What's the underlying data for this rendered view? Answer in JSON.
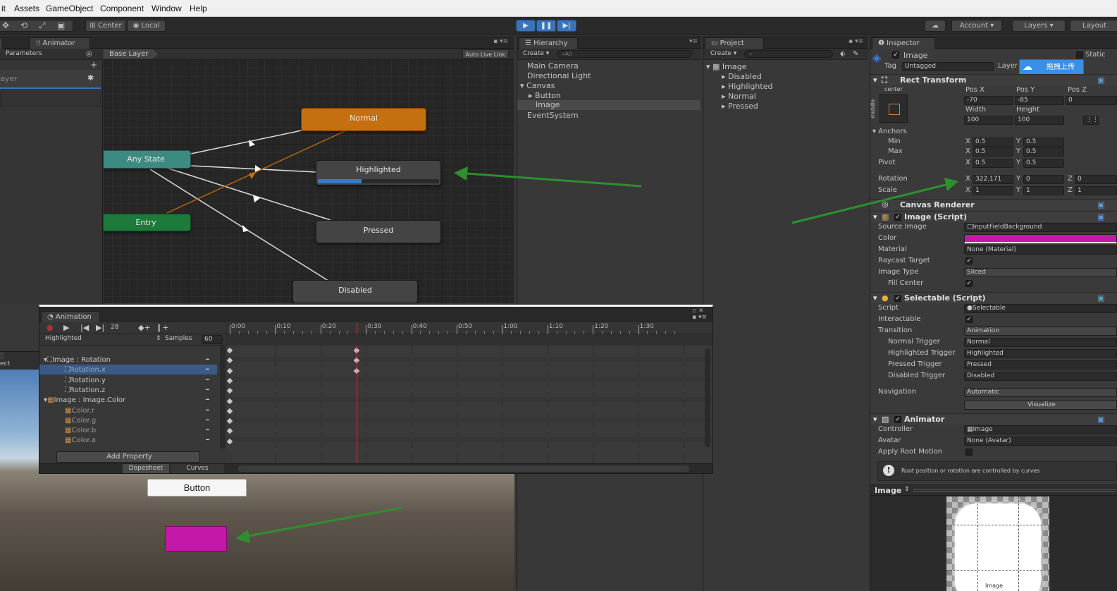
{
  "menu": [
    "it",
    "Assets",
    "GameObject",
    "Component",
    "Window",
    "Help"
  ],
  "toolbar": {
    "center": "Center",
    "local": "Local",
    "account": "Account",
    "layers": "Layers",
    "layout": "Layout"
  },
  "animator": {
    "tab": "Animator",
    "params_tab": "Parameters",
    "layer_partial": "ayer",
    "base_layer": "Base Layer",
    "auto_live_link": "Auto Live Link",
    "nodes": {
      "normal": "Normal",
      "any_state": "Any State",
      "highlighted": "Highlighted",
      "entry": "Entry",
      "pressed": "Pressed",
      "disabled": "Disabled"
    },
    "highlighted_progress": 0.36
  },
  "hierarchy": {
    "tab": "Hierarchy",
    "create": "Create",
    "search_placeholder": "All",
    "items": [
      "Main Camera",
      "Directional Light",
      "Canvas",
      "Button",
      "Image",
      "EventSystem"
    ]
  },
  "project": {
    "tab": "Project",
    "create": "Create",
    "items": [
      "Image",
      "Disabled",
      "Highlighted",
      "Normal",
      "Pressed"
    ]
  },
  "inspector": {
    "tab": "Inspector",
    "object_name": "Image",
    "static": "Static",
    "tag_label": "Tag",
    "tag_value": "Untagged",
    "layer_label": "Layer",
    "upload_btn": "拖拽上传",
    "rect": {
      "title": "Rect Transform",
      "anchor_preset": "center",
      "middle": "middle",
      "pos_x_label": "Pos X",
      "pos_y_label": "Pos Y",
      "pos_z_label": "Pos Z",
      "pos_x": "-70",
      "pos_y": "-85",
      "pos_z": "0",
      "width_label": "Width",
      "height_label": "Height",
      "width": "100",
      "height": "100",
      "anchors": "Anchors",
      "min": "Min",
      "max": "Max",
      "pivot": "Pivot",
      "min_x": "0.5",
      "min_y": "0.5",
      "max_x": "0.5",
      "max_y": "0.5",
      "pivot_x": "0.5",
      "pivot_y": "0.5",
      "rotation": "Rotation",
      "rot_x": "322.171",
      "rot_y": "0",
      "rot_z": "0",
      "scale": "Scale",
      "scale_x": "1",
      "scale_y": "1",
      "scale_z": "1"
    },
    "canvas_renderer": "Canvas Renderer",
    "image": {
      "title": "Image (Script)",
      "source_image": "Source Image",
      "source_value": "InputFieldBackground",
      "color": "Color",
      "color_value": "#c418a8",
      "material": "Material",
      "material_value": "None (Material)",
      "raycast": "Raycast Target",
      "image_type": "Image Type",
      "image_type_value": "Sliced",
      "fill_center": "Fill Center"
    },
    "selectable": {
      "title": "Selectable (Script)",
      "script": "Script",
      "script_value": "Selectable",
      "interactable": "Interactable",
      "transition": "Transition",
      "transition_value": "Animation",
      "normal_trigger": "Normal Trigger",
      "normal_value": "Normal",
      "highlighted_trigger": "Highlighted Trigger",
      "highlighted_value": "Highlighted",
      "pressed_trigger": "Pressed Trigger",
      "pressed_value": "Pressed",
      "disabled_trigger": "Disabled Trigger",
      "disabled_value": "Disabled",
      "navigation": "Navigation",
      "navigation_value": "Automatic",
      "visualize": "Visualize"
    },
    "animator": {
      "title": "Animator",
      "controller": "Controller",
      "controller_value": "Image",
      "avatar": "Avatar",
      "avatar_value": "None (Avatar)",
      "apply_root": "Apply Root Motion",
      "info": "Root position or rotation are controlled by curves"
    },
    "preview": {
      "title": "Image",
      "caption": "Image"
    }
  },
  "animation": {
    "tab": "Animation",
    "frame": "28",
    "clip": "Highlighted",
    "samples_label": "Samples",
    "samples": "60",
    "timeline": [
      "0:00",
      "0:10",
      "0:20",
      "0:30",
      "0:40",
      "0:50",
      "1:00",
      "1:10",
      "1:20",
      "1:30"
    ],
    "properties": [
      "Image : Rotation",
      "Rotation.x",
      "Rotation.y",
      "Rotation.z",
      "Image : Image.Color",
      "Color.r",
      "Color.g",
      "Color.b",
      "Color.a"
    ],
    "add_property": "Add Property",
    "dopesheet": "Dopesheet",
    "curves": "Curves"
  },
  "game": {
    "button": "Button",
    "ect": "ect"
  },
  "colors": {
    "accent": "#3a73b8",
    "arrow": "#2f8f2f",
    "magenta": "#c418a8"
  }
}
